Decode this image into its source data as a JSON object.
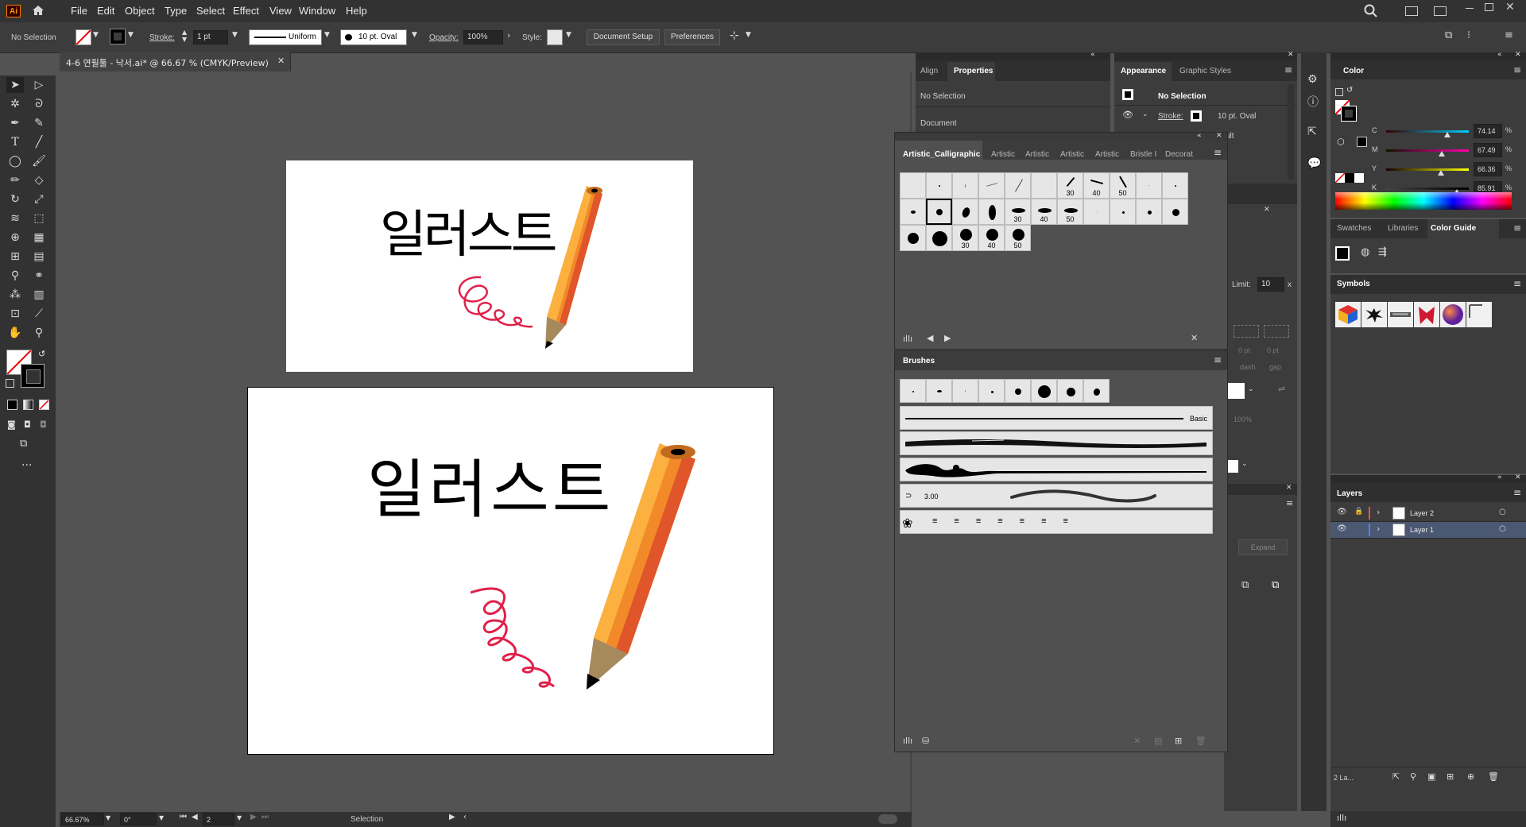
{
  "app": {
    "logo": "Ai"
  },
  "menu": [
    "File",
    "Edit",
    "Object",
    "Type",
    "Select",
    "Effect",
    "View",
    "Window",
    "Help"
  ],
  "control": {
    "selection": "No Selection",
    "stroke_label": "Stroke:",
    "stroke_weight": "1 pt",
    "profile": "Uniform",
    "brush": "10 pt. Oval",
    "opacity_label": "Opacity:",
    "opacity_value": "100%",
    "style_label": "Style:",
    "document_setup": "Document Setup",
    "preferences": "Preferences"
  },
  "document": {
    "tab_title": "4-6 연필툴 - 낙서.ai* @ 66.67 % (CMYK/Preview)",
    "artwork_text": "일러스트"
  },
  "status": {
    "zoom": "66.67%",
    "rotation": "0°",
    "artboard": "2",
    "tool": "Selection"
  },
  "properties_panel": {
    "tabs": [
      "Align",
      "Properties"
    ],
    "no_selection": "No Selection",
    "document": "Document"
  },
  "appearance_panel": {
    "tabs": [
      "Appearance",
      "Graphic Styles"
    ],
    "no_selection": "No Selection",
    "stroke_label": "Stroke:",
    "stroke_value": "10 pt. Oval",
    "fragment": "ult"
  },
  "calligraphic_panel": {
    "tabs": [
      "Artistic_Calligraphic",
      "Artistic",
      "Artistic",
      "Artistic",
      "Artistic",
      "Bristle I",
      "Decorat"
    ],
    "row1_labels": [
      "30",
      "40",
      "50"
    ],
    "row2_labels": [
      "30",
      "40",
      "50"
    ],
    "row3_labels": [
      "30",
      "40",
      "50"
    ]
  },
  "brushes_panel": {
    "title": "Brushes",
    "basic": "Basic",
    "size": "3.00"
  },
  "hidden_panel": {
    "limit_label": "Limit:",
    "limit_value": "10",
    "dash1": "0 pt",
    "dash2": "0 pt",
    "dash_label": "dash",
    "gap_label": "gap",
    "opacity": "100%",
    "expand": "Expand"
  },
  "color_panel": {
    "title": "Color",
    "channels": [
      {
        "name": "C",
        "value": "74.14",
        "pct": "%",
        "fraction": 0.7414
      },
      {
        "name": "M",
        "value": "67.49",
        "pct": "%",
        "fraction": 0.6749
      },
      {
        "name": "Y",
        "value": "66.36",
        "pct": "%",
        "fraction": 0.6636
      },
      {
        "name": "K",
        "value": "85.91",
        "pct": "%",
        "fraction": 0.8591
      }
    ]
  },
  "swatches_panel": {
    "tabs": [
      "Swatches",
      "Libraries",
      "Color Guide"
    ]
  },
  "symbols_panel": {
    "title": "Symbols"
  },
  "layers_panel": {
    "title": "Layers",
    "layers": [
      {
        "name": "Layer 2",
        "color": "#ff4f4f",
        "selected": false
      },
      {
        "name": "Layer 1",
        "color": "#4f7fff",
        "selected": true
      }
    ],
    "count": "2 La..."
  },
  "colors": {
    "accent": "#ff7c00",
    "pencil_orange": "#f28a2a",
    "scribble": "#e0204a"
  }
}
